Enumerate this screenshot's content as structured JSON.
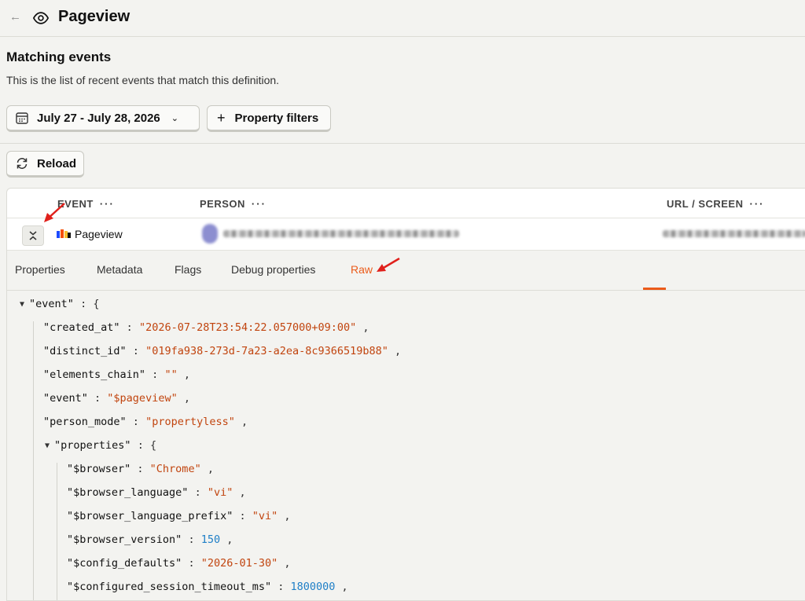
{
  "header": {
    "back_icon": "arrow-left-icon",
    "eye_icon": "eye-icon",
    "title": "Pageview"
  },
  "section": {
    "title": "Matching events",
    "description": "This is the list of recent events that match this definition."
  },
  "controls": {
    "date_range": "July 27 - July 28, 2026",
    "property_filters": "Property filters",
    "reload": "Reload"
  },
  "table": {
    "columns": [
      "EVENT",
      "PERSON",
      "URL / SCREEN"
    ],
    "column_menu": "···",
    "row": {
      "event": "Pageview"
    }
  },
  "detail": {
    "tabs": [
      "Properties",
      "Metadata",
      "Flags",
      "Debug properties",
      "Raw"
    ],
    "active_tab": "Raw",
    "accent_color": "#eb5b1a"
  },
  "raw_json": {
    "root_key": "\"event\"",
    "lines": [
      {
        "key": "\"created_at\"",
        "value": "\"2026-07-28T23:54:22.057000+09:00\"",
        "type": "string"
      },
      {
        "key": "\"distinct_id\"",
        "value": "\"019fa938-273d-7a23-a2ea-8c9366519b88\"",
        "type": "string"
      },
      {
        "key": "\"elements_chain\"",
        "value": "\"\"",
        "type": "string"
      },
      {
        "key": "\"event\"",
        "value": "\"$pageview\"",
        "type": "string"
      },
      {
        "key": "\"person_mode\"",
        "value": "\"propertyless\"",
        "type": "string"
      }
    ],
    "properties_key": "\"properties\"",
    "properties": [
      {
        "key": "\"$browser\"",
        "value": "\"Chrome\"",
        "type": "string"
      },
      {
        "key": "\"$browser_language\"",
        "value": "\"vi\"",
        "type": "string"
      },
      {
        "key": "\"$browser_language_prefix\"",
        "value": "\"vi\"",
        "type": "string"
      },
      {
        "key": "\"$browser_version\"",
        "value": "150",
        "type": "number"
      },
      {
        "key": "\"$config_defaults\"",
        "value": "\"2026-01-30\"",
        "type": "string"
      },
      {
        "key": "\"$configured_session_timeout_ms\"",
        "value": "1800000",
        "type": "number"
      }
    ]
  }
}
